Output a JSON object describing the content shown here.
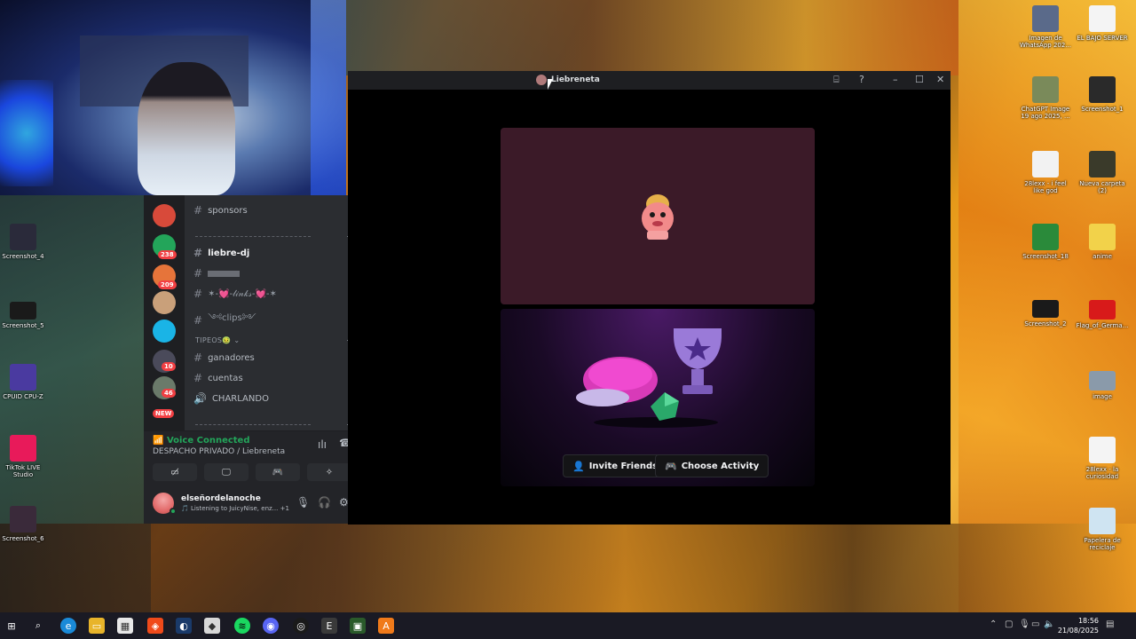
{
  "discord": {
    "servers": [
      {
        "badge": "238",
        "color": "#23a55a"
      },
      {
        "badge": "209",
        "color": "#e6743a"
      },
      {
        "badge": "",
        "color": "#c9a07a"
      },
      {
        "badge": "",
        "color": "#1ab4e6"
      },
      {
        "badge": "10",
        "color": "#4a4a5a"
      },
      {
        "badge": "46",
        "color": "#6a7a6a"
      },
      {
        "badge": "NEW",
        "color": "#f23f43"
      }
    ],
    "channels": {
      "sponsors": "sponsors",
      "liebre_dj": "liebre-dj",
      "links": "✶-💓-𝓁𝒾𝓃𝓀𝓈-💓-✶",
      "clips": "༺clips༻",
      "category_tipeos": "TIPEOS🤢",
      "ganadores": "ganadores",
      "cuentas": "cuentas",
      "charlando": "CHARLANDO"
    },
    "voice": {
      "title": "Voice Connected",
      "subtitle": "DESPACHO PRIVADO / Liebreneta"
    },
    "user": {
      "name": "elseñordelanoche",
      "status": "Listening to JuicyNise, enz...",
      "plus": "+1"
    }
  },
  "window": {
    "title": "Liebreneta",
    "invite_label": "Invite Friends",
    "activity_label": "Choose Activity"
  },
  "desktop": {
    "icons_left": [
      "Screenshot_4",
      "Screenshot_5",
      "CPUID CPU-Z",
      "TikTok LIVE Studio",
      "Screenshot_6"
    ],
    "icons_right_col1": [
      "Imagen de WhatsApp 202...",
      "ChatGPT Image 19 ago 2025, ...",
      "28lexx - i feel like god",
      "Screenshot_18",
      "Screenshot_2"
    ],
    "icons_right_col2": [
      "EL BAJO SERVER",
      "Screenshot_1",
      "Nueva carpeta (2)",
      "anime",
      "Flag_of_Germa...",
      "image",
      "28lexx - la curiosidad",
      "Papelera de reciclaje"
    ]
  },
  "taskbar": {
    "time": "18:56",
    "date": "21/08/2025"
  },
  "colors": {
    "voice_green": "#23a55a",
    "badge_red": "#f23f43",
    "discord_bg": "#2b2d31"
  }
}
